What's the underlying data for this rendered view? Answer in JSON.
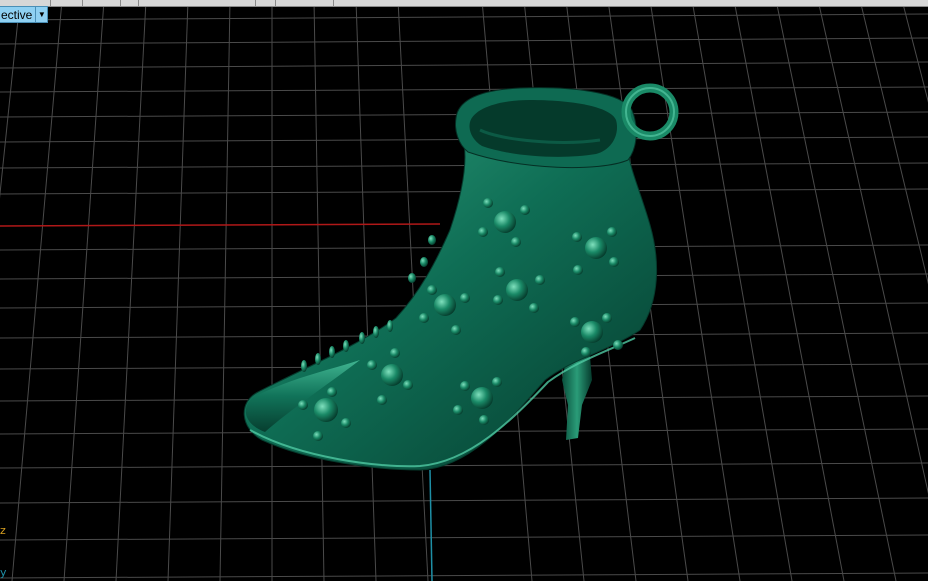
{
  "viewport": {
    "view_mode": "ective",
    "axis_z_label": "z",
    "axis_y_label": "y"
  },
  "icons": {
    "view_dropdown": "chevron-down-icon"
  },
  "colors": {
    "background": "#000000",
    "grid": "#4a4a4a",
    "x_axis": "#b01818",
    "y_axis": "#1e8fa6",
    "model": "#0f6e55",
    "model_highlight": "#3fb894",
    "model_shadow": "#053a2b",
    "viewmode_bg": "#8fd0f2"
  }
}
